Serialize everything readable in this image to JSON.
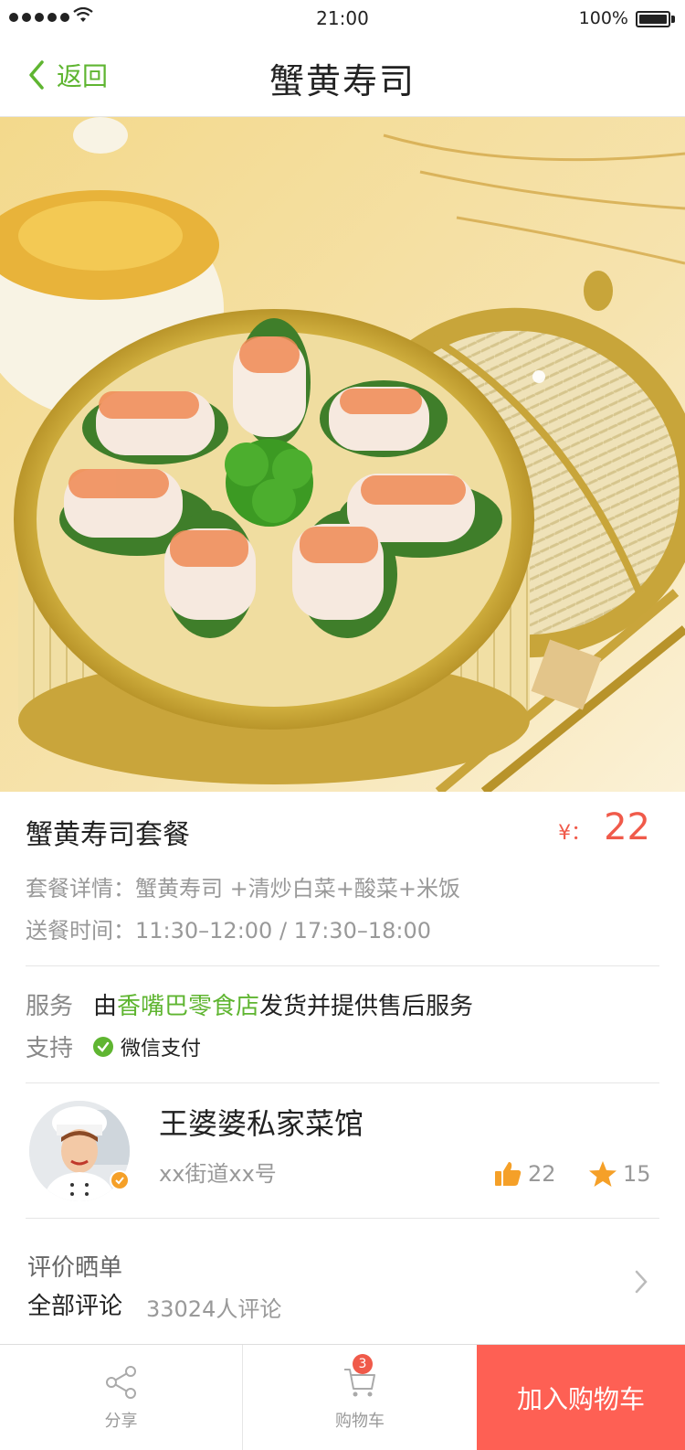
{
  "status_bar": {
    "time": "21:00",
    "battery": "100%"
  },
  "nav": {
    "back_label": "返回",
    "title": "蟹黄寿司"
  },
  "product": {
    "name": "蟹黄寿司套餐",
    "price_symbol": "¥：",
    "price": "22",
    "detail_label": "套餐详情：",
    "detail_value": "蟹黄寿司 +清炒白菜+酸菜+米饭",
    "time_label": "送餐时间：",
    "time_value": "11:30–12:00  /  17:30–18:00"
  },
  "service": {
    "label": "服务",
    "prefix": "由",
    "shop_link": "香嘴巴零食店",
    "suffix": "发货并提供售后服务",
    "support_label": "支持",
    "payment": "微信支付"
  },
  "shop": {
    "name": "王婆婆私家菜馆",
    "address": "xx街道xx号",
    "likes": "22",
    "favorites": "15"
  },
  "reviews": {
    "title": "评价晒单",
    "all_label": "全部评论",
    "count_text": "33024人评论"
  },
  "bottom_bar": {
    "share_label": "分享",
    "cart_label": "购物车",
    "cart_badge": "3",
    "add_to_cart": "加入购物车"
  },
  "colors": {
    "accent_green": "#5fb531",
    "price_red": "#f05a4a",
    "cta": "#fe6054",
    "star_orange": "#f5a028"
  }
}
